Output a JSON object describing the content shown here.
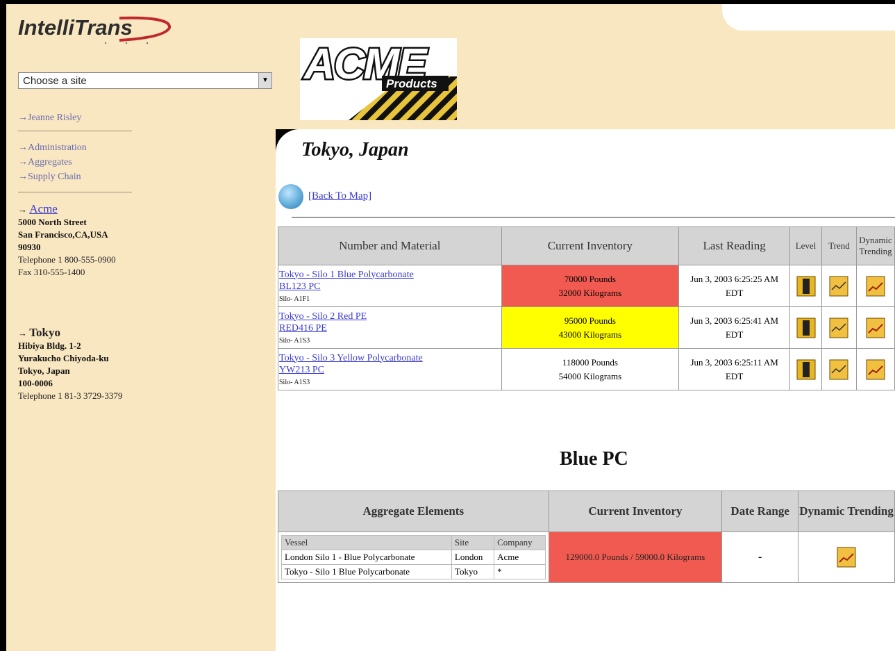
{
  "brand": {
    "intellitrans": "IntelliTrans",
    "acme": "ACME",
    "acme_sub": "Products"
  },
  "sidebar": {
    "site_select": {
      "value": "Choose a site"
    },
    "user": "Jeanne Risley",
    "nav": [
      {
        "label": "Administration"
      },
      {
        "label": "Aggregates"
      },
      {
        "label": "Supply Chain"
      }
    ],
    "company": {
      "name": "Acme",
      "street": "5000 North Street",
      "city": "San Francisco,CA,USA",
      "zip": "90930",
      "phone": "Telephone 1 800-555-0900",
      "fax": "Fax 310-555-1400"
    },
    "site": {
      "name": "Tokyo",
      "line1": "Hibiya Bldg. 1-2",
      "line2": "Yurakucho Chiyoda-ku",
      "line3": "Tokyo, Japan",
      "zip": "100-0006",
      "phone": "Telephone 1 81-3 3729-3379"
    }
  },
  "page": {
    "title": "Tokyo, Japan",
    "back_link": "[Back To Map]"
  },
  "silo_table": {
    "headers": [
      "Number and Material",
      "Current Inventory",
      "Last Reading",
      "Level",
      "Trend",
      "Dynamic Trending"
    ],
    "rows": [
      {
        "name": "Tokyo - Silo 1 Blue Polycarbonate",
        "code": "BL123 PC",
        "silo": "Silo- A1F1",
        "pounds": "70000 Pounds",
        "kg": "32000 Kilograms",
        "reading": "Jun 3, 2003 6:25:25 AM",
        "tz": "EDT",
        "status": "red"
      },
      {
        "name": "Tokyo - Silo 2 Red PE",
        "code": "RED416 PE",
        "silo": "Silo- A1S3",
        "pounds": "95000 Pounds",
        "kg": "43000 Kilograms",
        "reading": "Jun 3, 2003 6:25:41 AM",
        "tz": "EDT",
        "status": "yellow"
      },
      {
        "name": "Tokyo - Silo 3 Yellow Polycarbonate",
        "code": "YW213 PC",
        "silo": "Silo- A1S3",
        "pounds": "118000 Pounds",
        "kg": "54000 Kilograms",
        "reading": "Jun 3, 2003 6:25:11 AM",
        "tz": "EDT",
        "status": "white"
      }
    ]
  },
  "aggregate": {
    "title": "Blue PC",
    "headers": [
      "Aggregate Elements",
      "Current Inventory",
      "Date Range",
      "Dynamic Trending"
    ],
    "inner_headers": [
      "Vessel",
      "Site",
      "Company"
    ],
    "elements": [
      {
        "vessel": "London Silo 1 - Blue Polycarbonate",
        "site": "London",
        "company": "Acme"
      },
      {
        "vessel": "Tokyo - Silo 1 Blue Polycarbonate",
        "site": "Tokyo",
        "company": "*"
      }
    ],
    "inventory": "129000.0 Pounds / 59000.0 Kilograms",
    "date_range": "-"
  },
  "colors": {
    "sidebar_bg": "#f9e7c1",
    "alert_red": "#f05a50",
    "alert_yellow": "#ffff00",
    "header_gray": "#d4d4d4"
  }
}
